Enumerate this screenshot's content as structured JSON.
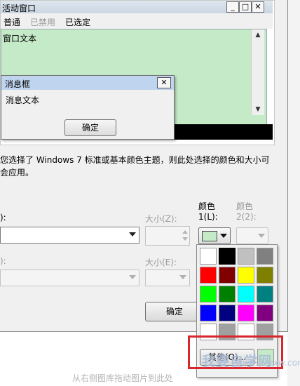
{
  "preview": {
    "inactive_title": "活动窗口",
    "menu": [
      "普通",
      "已禁用",
      "已选定"
    ],
    "window_text": "窗口文本",
    "msgbox_title": "消息框",
    "msgbox_text": "消息文本",
    "msgbox_ok": "确定"
  },
  "description": "您选择了 Windows 7 标准或基本颜色主题，则此处选择的颜色和大小可会应用。",
  "controls": {
    "item_label_fragment": "):",
    "size_label": "大小(Z):",
    "color1_label_line1": "颜色",
    "color1_label_line2": "1(L):",
    "color2_label_line1": "颜色",
    "color2_label_line2": "2(2):",
    "font_label_fragment": "):",
    "font_size_label": "大小(E):",
    "color1_value": "#c5eac8",
    "ok_button": "确定"
  },
  "palette": {
    "colors": [
      "#ffffff",
      "#000000",
      "#c0c0c0",
      "#808080",
      "#ff0000",
      "#800000",
      "#ffff00",
      "#808000",
      "#00ff00",
      "#008000",
      "#00ffff",
      "#008080",
      "#0000ff",
      "#000080",
      "#ff00ff",
      "#800080",
      "#ffffff",
      "#a0a0a0",
      "#ffffff",
      "#a0a0a0"
    ],
    "selected_index": 1,
    "other_button": "其他(O)...",
    "current_color": "#c5eac8"
  },
  "watermark": {
    "logo": "我要自学网",
    "url": "www.52zxw.com",
    "drag_hint": "从右侧图库拖动图片到此处"
  },
  "highlight_color": "#d8262c"
}
